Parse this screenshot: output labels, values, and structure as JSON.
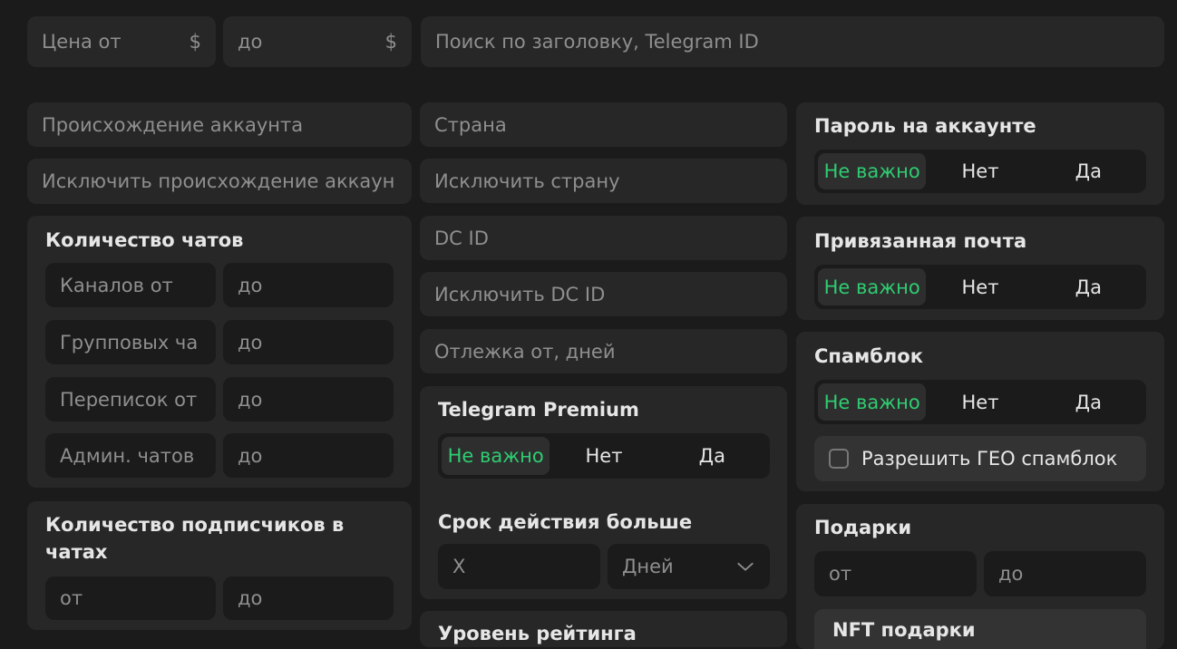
{
  "top": {
    "price_from": {
      "placeholder": "Цена от",
      "currency": "$"
    },
    "price_to": {
      "placeholder": "до",
      "currency": "$"
    },
    "search": {
      "placeholder": "Поиск по заголовку, Telegram ID"
    }
  },
  "col1": {
    "origin": "Происхождение аккаунта",
    "exclude_origin": "Исключить происхождение аккаун",
    "chats": {
      "title": "Количество чатов",
      "rows": [
        {
          "from": "Каналов от",
          "to": "до"
        },
        {
          "from": "Групповых ча",
          "to": "до"
        },
        {
          "from": "Переписок от",
          "to": "до"
        },
        {
          "from": "Админ. чатов",
          "to": "до"
        }
      ]
    },
    "subscribers": {
      "title_line1": "Количество подписчиков в",
      "title_line2": "чатах",
      "from": "от",
      "to": "до"
    }
  },
  "col2": {
    "country": "Страна",
    "exclude_country": "Исключить страну",
    "dc_id": "DC ID",
    "exclude_dc_id": "Исключить DC ID",
    "idle": "Отлежка от, дней",
    "premium": {
      "title": "Telegram Premium",
      "options": [
        "Не важно",
        "Нет",
        "Да"
      ]
    },
    "expiry": {
      "title": "Срок действия больше",
      "value_placeholder": "X",
      "unit": "Дней"
    },
    "rating_title": "Уровень рейтинга"
  },
  "col3": {
    "password": {
      "title": "Пароль на аккаунте",
      "options": [
        "Не важно",
        "Нет",
        "Да"
      ]
    },
    "email": {
      "title": "Привязанная почта",
      "options": [
        "Не важно",
        "Нет",
        "Да"
      ]
    },
    "spamblock": {
      "title": "Спамблок",
      "options": [
        "Не важно",
        "Нет",
        "Да"
      ],
      "geo_label": "Разрешить ГЕО спамблок"
    },
    "gifts": {
      "title": "Подарки",
      "from": "от",
      "to": "до",
      "nft_title": "NFT подарки"
    }
  },
  "colors": {
    "accent": "#2ecc71",
    "background": "#1b1b1b",
    "panel": "#272727"
  }
}
